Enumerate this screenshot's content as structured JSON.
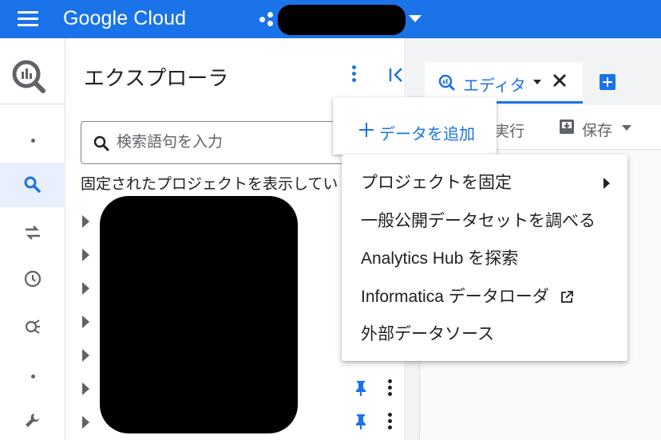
{
  "topbar": {
    "brand": "Google Cloud",
    "menu_icon": "hamburger-menu-icon",
    "project_icon": "project-hub-icon",
    "background": "#1a73e8"
  },
  "rail": {
    "logo_icon": "bigquery-logo-icon",
    "items": [
      {
        "icon": "dot-icon",
        "active": false
      },
      {
        "icon": "search-icon",
        "active": true
      },
      {
        "icon": "transfer-icon",
        "active": false
      },
      {
        "icon": "history-clock-icon",
        "active": false
      },
      {
        "icon": "analytics-icon",
        "active": false
      },
      {
        "icon": "dot-icon",
        "active": false
      },
      {
        "icon": "wrench-icon",
        "active": false
      }
    ]
  },
  "explorer": {
    "title": "エクスプローラ",
    "search_placeholder": "検索語句を入力",
    "pinned_text": "固定されたプロジェクトを表示してい"
  },
  "editor": {
    "tab_label": "エディタ",
    "run_label": "実行",
    "save_label": "保存"
  },
  "add_data": {
    "label": "データを追加"
  },
  "menu": {
    "items": [
      {
        "label": "プロジェクトを固定",
        "has_submenu": true
      },
      {
        "label": "一般公開データセットを調べる"
      },
      {
        "label": "Analytics Hub を探索"
      },
      {
        "label": "Informatica データローダ",
        "external": true
      },
      {
        "label": "外部データソース"
      }
    ]
  },
  "accent_color": "#1a73e8"
}
